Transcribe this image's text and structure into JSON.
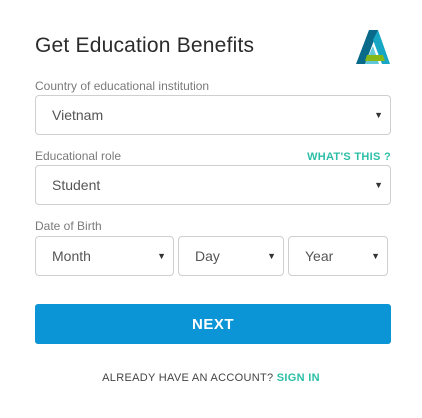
{
  "header": {
    "title": "Get Education Benefits",
    "logo_icon": "autodesk-logo"
  },
  "country": {
    "label": "Country of educational institution",
    "value": "Vietnam"
  },
  "role": {
    "label": "Educational role",
    "help_link": "WHAT'S THIS ?",
    "value": "Student"
  },
  "dob": {
    "label": "Date of Birth",
    "month": "Month",
    "day": "Day",
    "year": "Year"
  },
  "actions": {
    "next_label": "NEXT",
    "account_prompt": "ALREADY HAVE AN ACCOUNT?",
    "signin_label": "SIGN IN"
  },
  "colors": {
    "primary_button": "#0b94d6",
    "link": "#2bbfa7"
  }
}
